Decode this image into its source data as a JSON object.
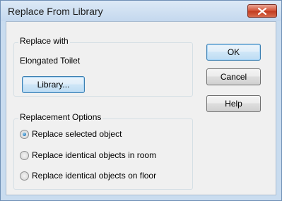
{
  "window": {
    "title": "Replace From Library",
    "close_icon": "close-icon"
  },
  "replace_with": {
    "legend": "Replace with",
    "object_name": "Elongated Toilet",
    "library_button": "Library..."
  },
  "options": {
    "legend": "Replacement Options",
    "items": [
      {
        "label": "Replace selected object",
        "checked": true
      },
      {
        "label": "Replace identical objects in room",
        "checked": false
      },
      {
        "label": "Replace identical objects on floor",
        "checked": false
      }
    ]
  },
  "buttons": {
    "ok": "OK",
    "cancel": "Cancel",
    "help": "Help"
  }
}
